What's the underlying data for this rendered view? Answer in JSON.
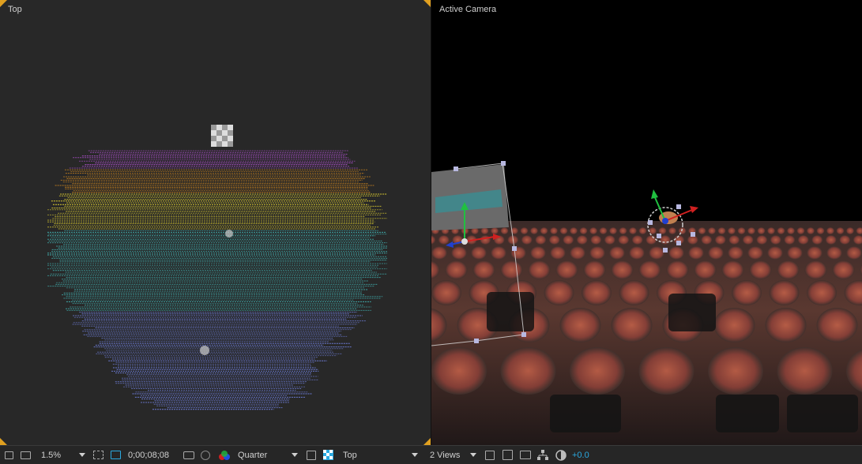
{
  "views": {
    "left_title": "Top",
    "right_title": "Active Camera"
  },
  "toolbar": {
    "zoom": "1.5%",
    "timecode": "0;00;08;08",
    "resolution": "Quarter",
    "view_select": "Top",
    "layout": "2 Views",
    "exposure": "+0.0"
  },
  "colors": {
    "accent": "#e0a020",
    "exposure_blue": "#2aa9e0",
    "purple": "#b050d0",
    "orange": "#e0901c",
    "yellow": "#e0d030",
    "teal": "#40b0b0",
    "blue": "#7080e0"
  },
  "icons": [
    "monitor-icon",
    "region-of-interest-icon",
    "transparency-grid-icon",
    "camera-snapshot-icon",
    "show-snapshot-icon",
    "color-channels-icon",
    "fast-preview-icon",
    "flowchart-icon",
    "exposure-reset-icon"
  ]
}
